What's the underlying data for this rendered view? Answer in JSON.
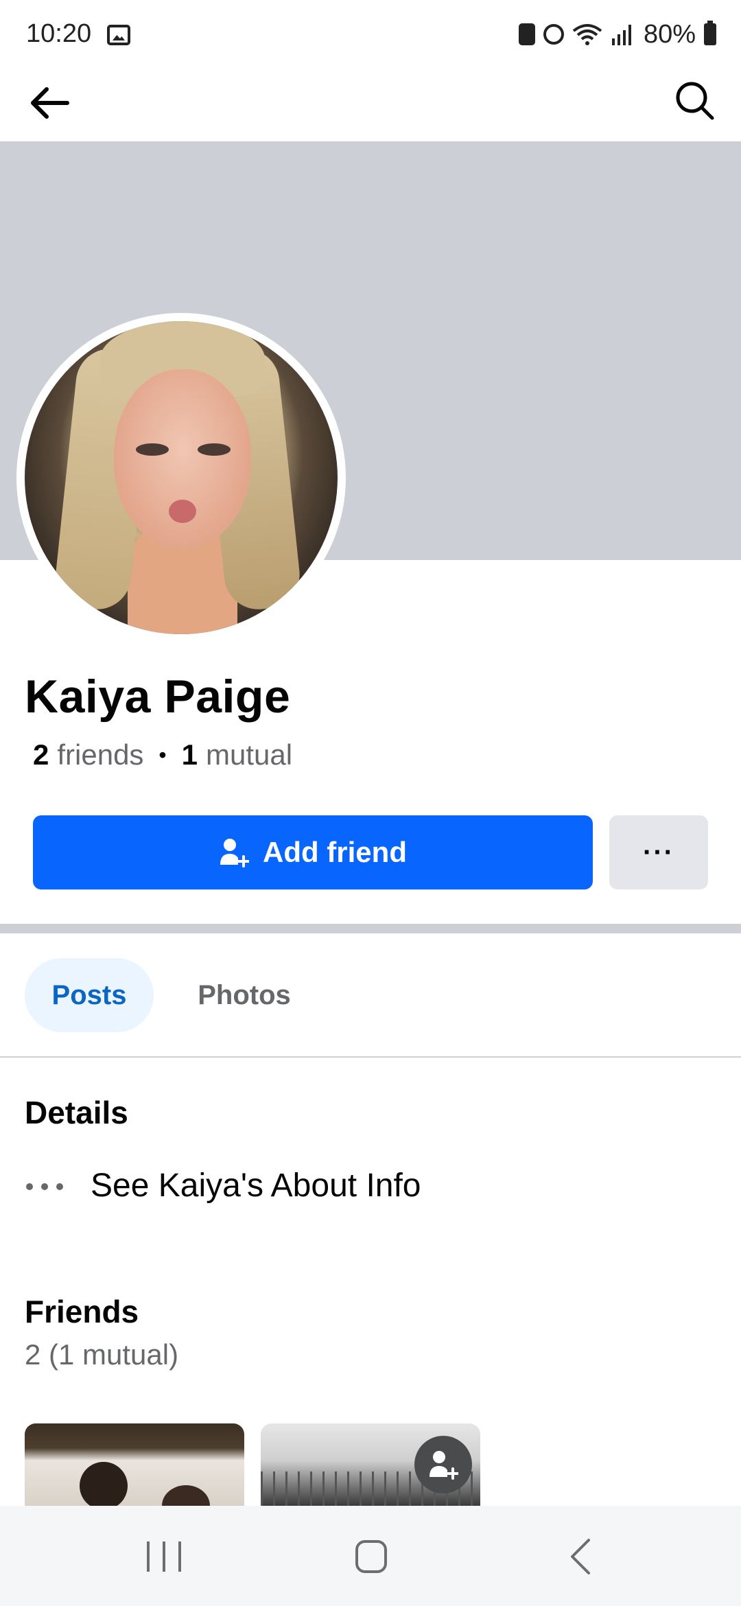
{
  "status_bar": {
    "time": "10:20",
    "battery_percent": "80%",
    "icons": [
      "image-icon",
      "battery-saver-icon",
      "alarm-icon",
      "wifi-icon",
      "signal-icon",
      "battery-icon"
    ]
  },
  "top_nav": {
    "back_icon": "arrow-left",
    "search_icon": "search"
  },
  "profile": {
    "name": "Kaiya Paige",
    "friends_count": "2",
    "friends_label": "friends",
    "mutual_count": "1",
    "mutual_label": "mutual",
    "separator": "•"
  },
  "actions": {
    "add_friend_label": "Add friend",
    "more_label": "···",
    "primary_color": "#0866ff"
  },
  "tabs": [
    {
      "label": "Posts",
      "active": true
    },
    {
      "label": "Photos",
      "active": false
    }
  ],
  "details": {
    "heading": "Details",
    "about_link": "See Kaiya's About Info"
  },
  "friends": {
    "heading": "Friends",
    "count_text": "2 (1 mutual)"
  },
  "nav_bar": {
    "buttons": [
      "recents",
      "home",
      "back"
    ]
  }
}
